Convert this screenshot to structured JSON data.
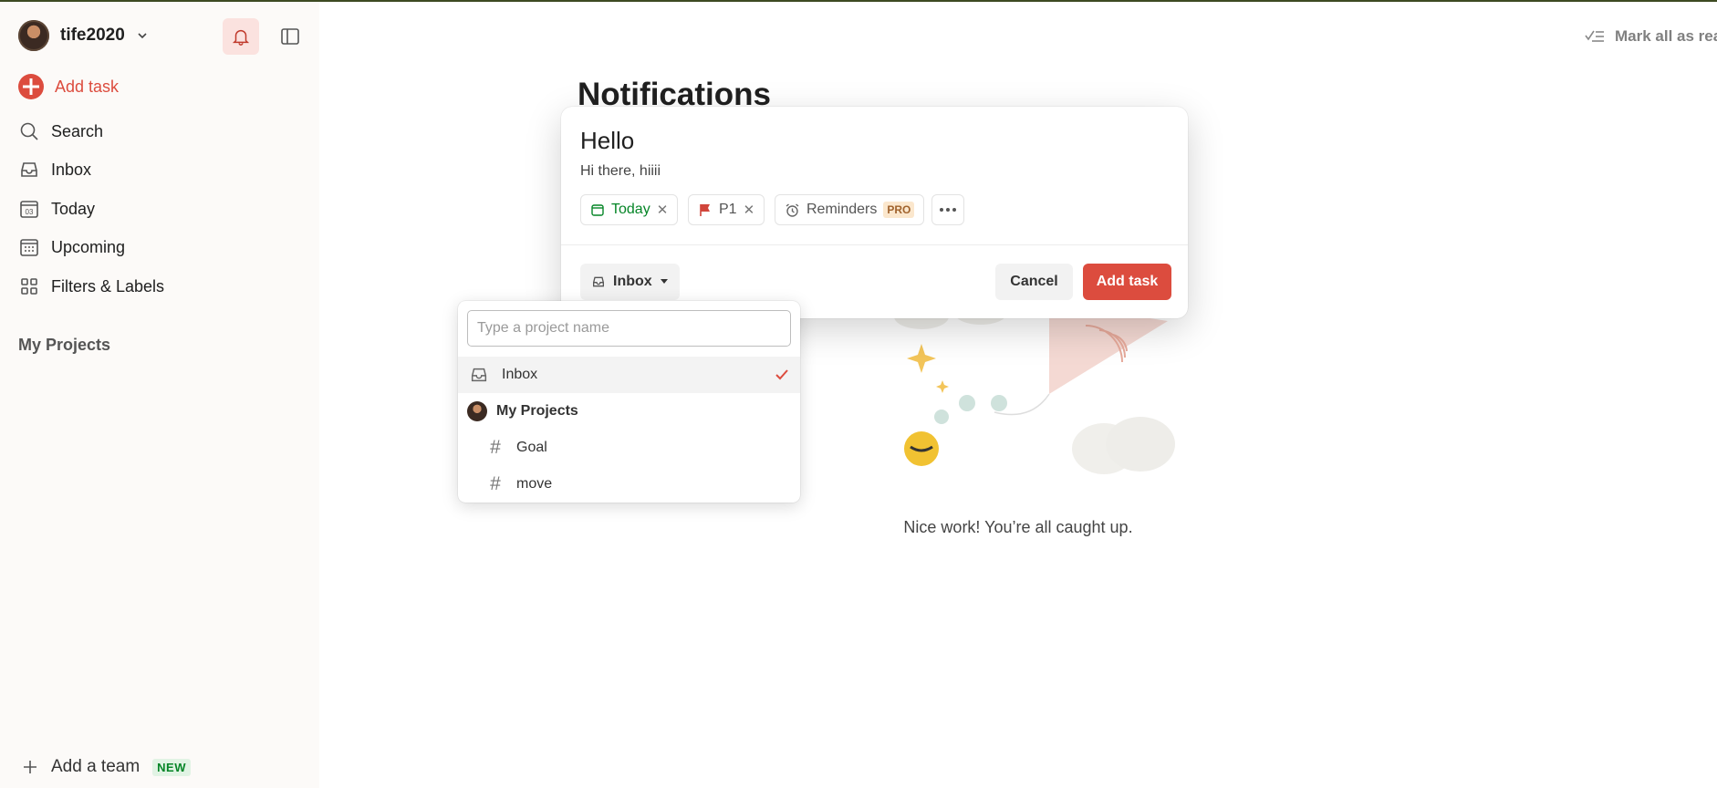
{
  "sidebar": {
    "username": "tife2020",
    "add_task": "Add task",
    "nav": [
      {
        "label": "Search",
        "icon": "search-icon"
      },
      {
        "label": "Inbox",
        "icon": "inbox-icon"
      },
      {
        "label": "Today",
        "icon": "calendar-today-icon"
      },
      {
        "label": "Upcoming",
        "icon": "calendar-grid-icon"
      },
      {
        "label": "Filters & Labels",
        "icon": "grid-icon"
      }
    ],
    "projects_heading": "My Projects",
    "add_team": "Add a team",
    "new_badge": "NEW"
  },
  "main": {
    "mark_all_read": "Mark all as read",
    "title": "Notifications",
    "empty_message": "Nice work! You’re all caught up."
  },
  "task_modal": {
    "task_name": "Hello",
    "description": "Hi there, hiiii",
    "chips": {
      "date": "Today",
      "priority": "P1",
      "reminders": "Reminders",
      "pro_badge": "PRO"
    },
    "project_button": "Inbox",
    "cancel": "Cancel",
    "submit": "Add task"
  },
  "project_dropdown": {
    "placeholder": "Type a project name",
    "selected": "Inbox",
    "group_label": "My Projects",
    "projects": [
      "Goal",
      "move"
    ]
  },
  "colors": {
    "accent": "#dc4c3e",
    "green": "#058527",
    "sidebar_bg": "#fcfaf8"
  }
}
